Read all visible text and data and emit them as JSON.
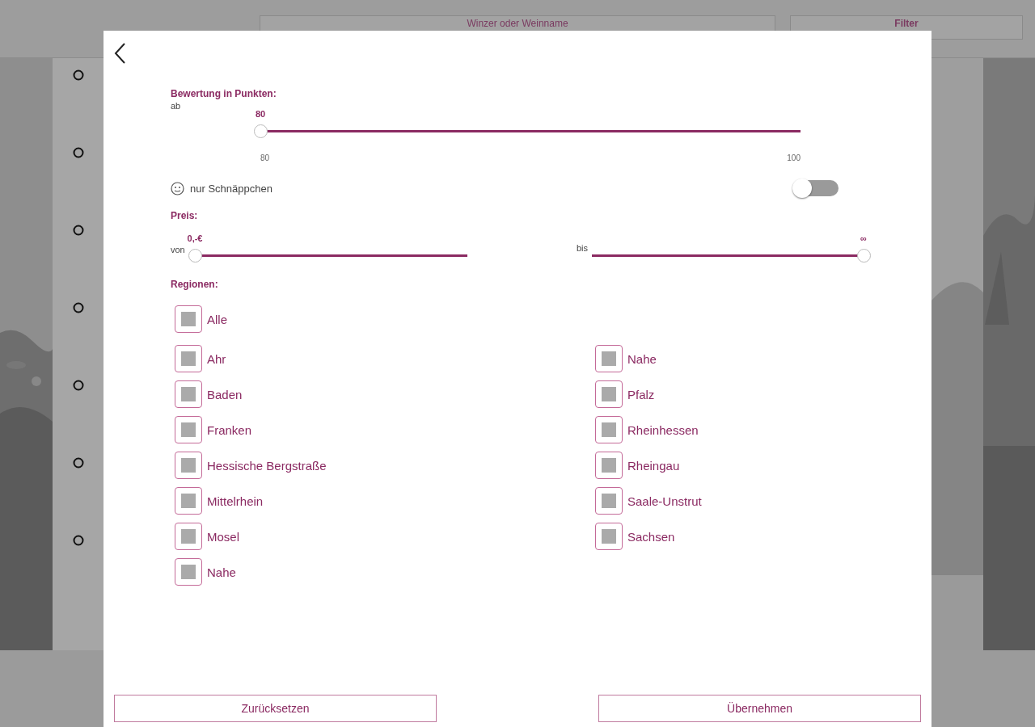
{
  "background": {
    "search": {
      "placeholder": "Winzer oder Weinname"
    },
    "filter_button": "Filter"
  },
  "dialog": {
    "rating": {
      "title": "Bewertung in Punkten:",
      "prefix": "ab",
      "value": "80",
      "level": 0,
      "min": "80",
      "max": "100"
    },
    "bargain": {
      "label": "nur Schnäppchen",
      "on": false
    },
    "price": {
      "title": "Preis:",
      "from": {
        "prefix": "von",
        "value": "0,-€",
        "level": 0
      },
      "to": {
        "prefix": "bis",
        "value": "∞",
        "level": 1
      }
    },
    "regions": {
      "title": "Regionen:",
      "all": {
        "label": "Alle",
        "checked": false
      },
      "left": [
        {
          "label": "Ahr",
          "checked": false
        },
        {
          "label": "Baden",
          "checked": false
        },
        {
          "label": "Franken",
          "checked": false
        },
        {
          "label": "Hessische Bergstraße",
          "checked": false
        },
        {
          "label": "Mittelrhein",
          "checked": false
        },
        {
          "label": "Mosel",
          "checked": false
        },
        {
          "label": "Nahe",
          "checked": false
        }
      ],
      "right": [
        {
          "label": "Nahe",
          "checked": false
        },
        {
          "label": "Pfalz",
          "checked": false
        },
        {
          "label": "Rheinhessen",
          "checked": false
        },
        {
          "label": "Rheingau",
          "checked": false
        },
        {
          "label": "Saale-Unstrut",
          "checked": false
        },
        {
          "label": "Sachsen",
          "checked": false
        }
      ]
    },
    "buttons": [
      "Zurücksetzen",
      "Übernehmen"
    ]
  }
}
